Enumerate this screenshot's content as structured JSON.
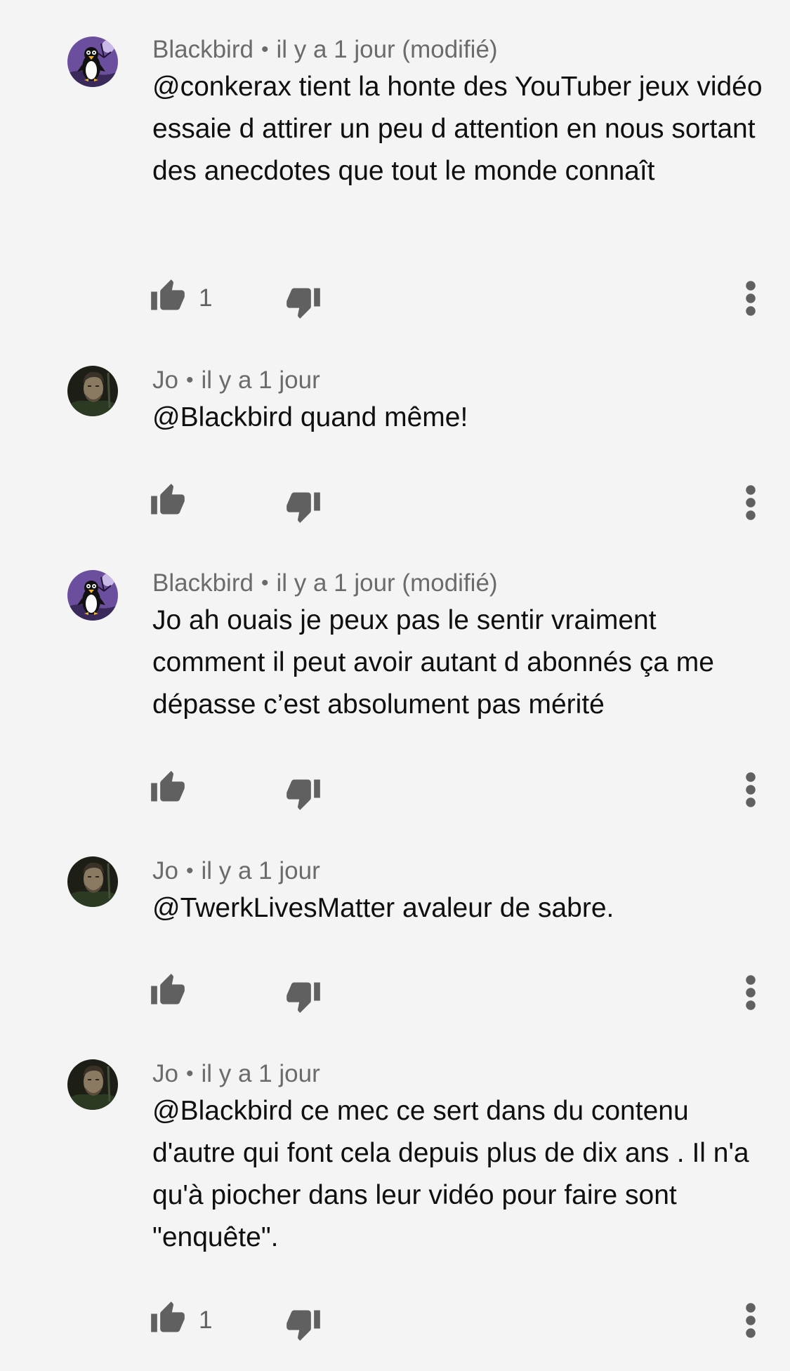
{
  "comments": [
    {
      "author": "Blackbird",
      "separator": "•",
      "time": "il y a 1 jour (modifié)",
      "text": "@conkerax tient la honte des YouTuber jeux vidéo essaie d attirer un peu d attention en nous sortant des anecdotes que tout le monde connaît",
      "likes": "1",
      "avatar_icon": "penguin-avatar-icon"
    },
    {
      "author": "Jo",
      "separator": "•",
      "time": "il y a 1 jour",
      "text": "@Blackbird quand même!",
      "likes": "",
      "avatar_icon": "man-portrait-avatar-icon"
    },
    {
      "author": "Blackbird",
      "separator": "•",
      "time": "il y a 1 jour (modifié)",
      "text": "Jo ah ouais je peux pas le sentir vraiment comment il peut avoir autant d abonnés ça me dépasse c’est absolument pas mérité",
      "likes": "",
      "avatar_icon": "penguin-avatar-icon"
    },
    {
      "author": "Jo",
      "separator": "•",
      "time": "il y a 1 jour",
      "text": "@TwerkLivesMatter avaleur de sabre.",
      "likes": "",
      "avatar_icon": "man-portrait-avatar-icon"
    },
    {
      "author": "Jo",
      "separator": "•",
      "time": "il y a 1 jour",
      "text": "@Blackbird ce mec ce sert dans du contenu d'autre qui font cela depuis plus de dix ans . Il n'a qu'à piocher dans leur vidéo pour faire sont \"enquête\".",
      "likes": "1",
      "avatar_icon": "man-portrait-avatar-icon"
    }
  ],
  "icons": {
    "like": "thumb-up-icon",
    "dislike": "thumb-down-icon",
    "more": "more-vertical-icon"
  },
  "colors": {
    "background": "#f4f4f4",
    "meta_text": "#6b6b6b",
    "icon": "#606060",
    "body_text": "#0f0f0f",
    "penguin_avatar_bg": "#6b4f9e"
  }
}
